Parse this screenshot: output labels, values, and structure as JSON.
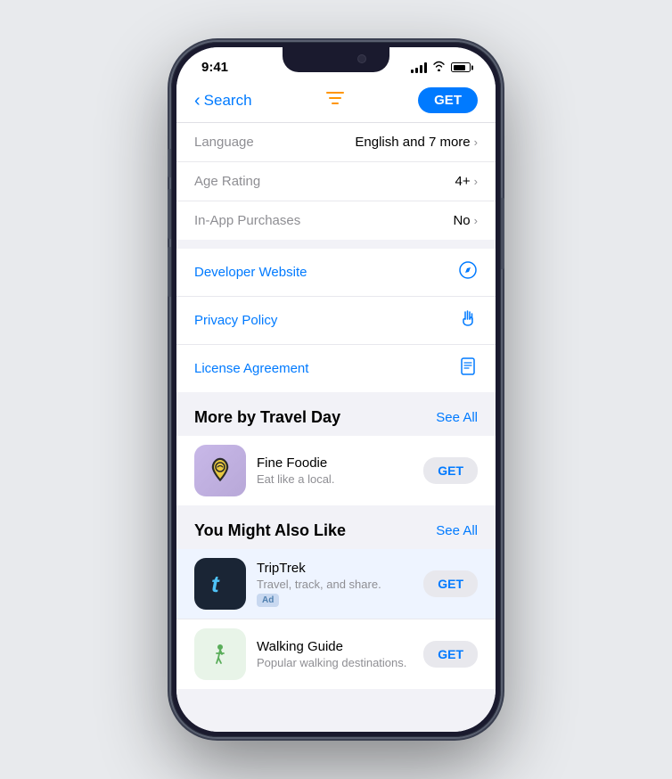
{
  "phone": {
    "status_bar": {
      "time": "9:41"
    },
    "nav": {
      "back_label": "Search",
      "get_label": "GET"
    },
    "info_rows": [
      {
        "label": "Language",
        "value": "English and 7 more",
        "has_chevron": true
      },
      {
        "label": "Age Rating",
        "value": "4+",
        "has_chevron": true
      },
      {
        "label": "In-App Purchases",
        "value": "No",
        "has_chevron": true
      }
    ],
    "link_rows": [
      {
        "label": "Developer Website",
        "icon": "compass"
      },
      {
        "label": "Privacy Policy",
        "icon": "hand"
      },
      {
        "label": "License Agreement",
        "icon": "doc"
      }
    ],
    "more_by_section": {
      "title": "More by Travel Day",
      "see_all": "See All",
      "apps": [
        {
          "name": "Fine Foodie",
          "desc": "Eat like a local.",
          "get_label": "GET"
        }
      ]
    },
    "you_might_section": {
      "title": "You Might Also Like",
      "see_all": "See All",
      "apps": [
        {
          "name": "TripTrek",
          "desc": "Travel, track, and share.",
          "ad": "Ad",
          "get_label": "GET",
          "highlighted": true
        },
        {
          "name": "Walking Guide",
          "desc": "Popular walking destinations.",
          "get_label": "GET",
          "highlighted": false
        }
      ]
    }
  }
}
